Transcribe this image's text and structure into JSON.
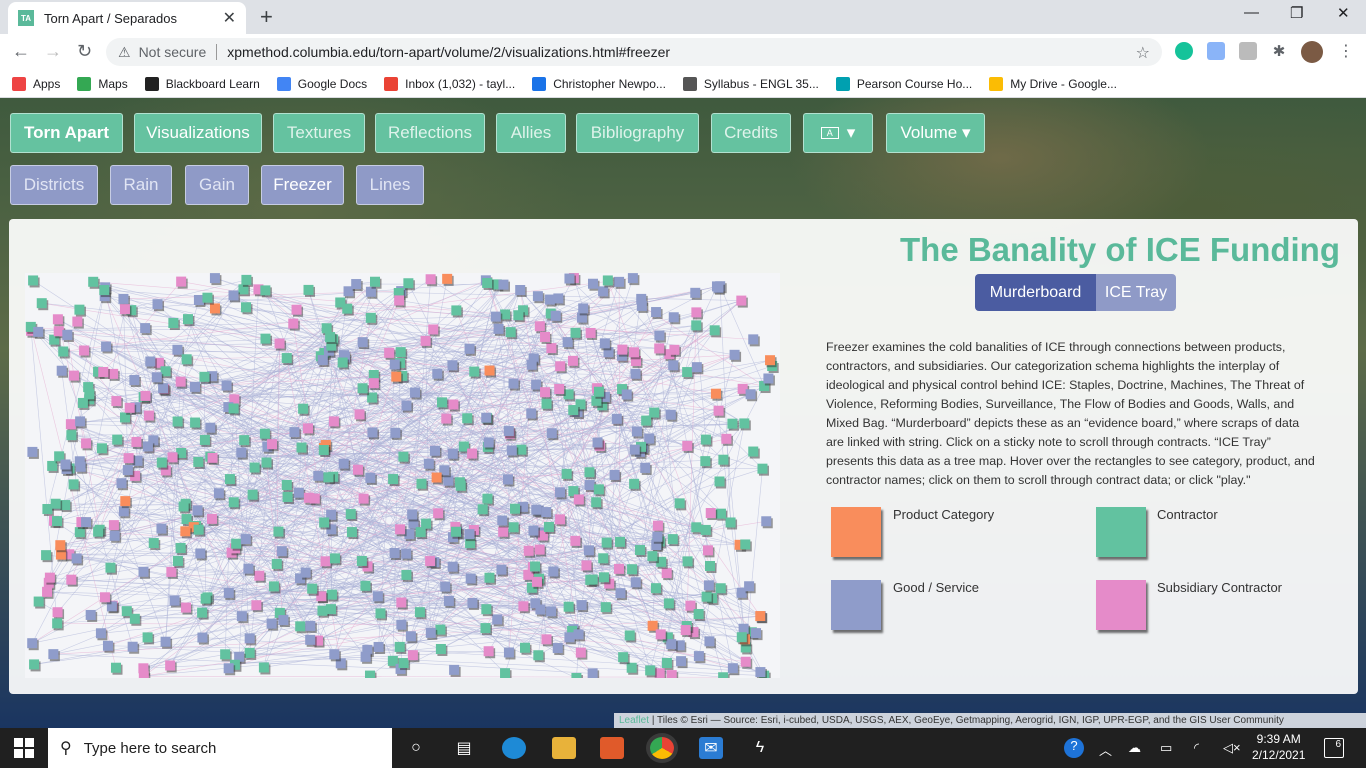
{
  "browser": {
    "tab_title": "Torn Apart / Separados",
    "tab_close": "✕",
    "new_tab": "+",
    "min": "—",
    "restore": "❐",
    "close": "✕",
    "back": "←",
    "forward": "→",
    "reload": "↻",
    "warning_icon": "⚠",
    "not_secure": "Not secure",
    "url": "xpmethod.columbia.edu/torn-apart/volume/2/visualizations.html#freezer",
    "star": "☆",
    "more": "⋮",
    "bookmarks": [
      {
        "label": "Apps",
        "icon": "apps-icon",
        "color": "#e44"
      },
      {
        "label": "Maps",
        "icon": "maps-icon",
        "color": "#34a853"
      },
      {
        "label": "Blackboard Learn",
        "icon": "blackboard-icon",
        "color": "#222"
      },
      {
        "label": "Google Docs",
        "icon": "docs-icon",
        "color": "#4285f4"
      },
      {
        "label": "Inbox (1,032) - tayl...",
        "icon": "gmail-icon",
        "color": "#ea4335"
      },
      {
        "label": "Christopher Newpo...",
        "icon": "calendar-icon",
        "color": "#1a73e8"
      },
      {
        "label": "Syllabus - ENGL 35...",
        "icon": "globe-icon",
        "color": "#555"
      },
      {
        "label": "Pearson Course Ho...",
        "icon": "pearson-icon",
        "color": "#00a0b0"
      },
      {
        "label": "My Drive - Google...",
        "icon": "drive-icon",
        "color": "#fbbc04"
      }
    ]
  },
  "nav": {
    "primary": [
      "Torn Apart",
      "Visualizations",
      "Textures",
      "Reflections",
      "Allies",
      "Bibliography",
      "Credits",
      "▾",
      "Volume ▾"
    ],
    "secondary": [
      "Districts",
      "Rain",
      "Gain",
      "Freezer",
      "Lines"
    ]
  },
  "panel": {
    "title": "The Banality of ICE Funding",
    "seg_murderboard": "Murderboard",
    "seg_icetray": "ICE Tray",
    "description": "Freezer examines the cold banalities of ICE through connections between products, contractors, and subsidiaries. Our categorization schema highlights the interplay of ideological and physical control behind ICE: Staples, Doctrine, Machines, The Threat of Violence, Reforming Bodies, Surveillance, The Flow of Bodies and Goods, Walls, and Mixed Bag. “Murderboard” depicts these as an “evidence board,” where scraps of data are linked with string. Click on a sticky note to scroll through contracts. “ICE Tray” presents this data as a tree map. Hover over the rectangles to see category, product, and contractor names; click on them to scroll through contract data; or click \"play.\"",
    "legend": [
      {
        "label": "Product Category",
        "color": "#f98d5c"
      },
      {
        "label": "Contractor",
        "color": "#62c2a0"
      },
      {
        "label": "Good / Service",
        "color": "#8f9cca"
      },
      {
        "label": "Subsidiary Contractor",
        "color": "#e58bc9"
      }
    ]
  },
  "attribution": {
    "leaflet": "Leaflet",
    "text": "| Tiles © Esri — Source: Esri, i-cubed, USDA, USGS, AEX, GeoEye, Getmapping, Aerogrid, IGN, IGP, UPR-EGP, and the GIS User Community"
  },
  "taskbar": {
    "search_placeholder": "Type here to search",
    "time": "9:39 AM",
    "date": "2/12/2021",
    "notifications": "6"
  }
}
